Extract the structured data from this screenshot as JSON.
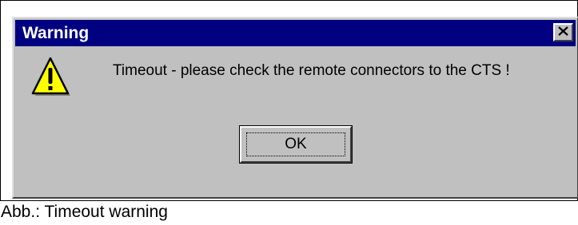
{
  "dialog": {
    "title": "Warning",
    "close_icon": "close-icon",
    "warning_icon": "warning-triangle-icon",
    "message": "Timeout - please check the remote connectors to the CTS !",
    "ok_label": "OK"
  },
  "caption": "Abb.: Timeout warning",
  "colors": {
    "title_bar": "#000080",
    "dialog_face": "#c0c0c0",
    "icon_fill": "#ffff00"
  }
}
